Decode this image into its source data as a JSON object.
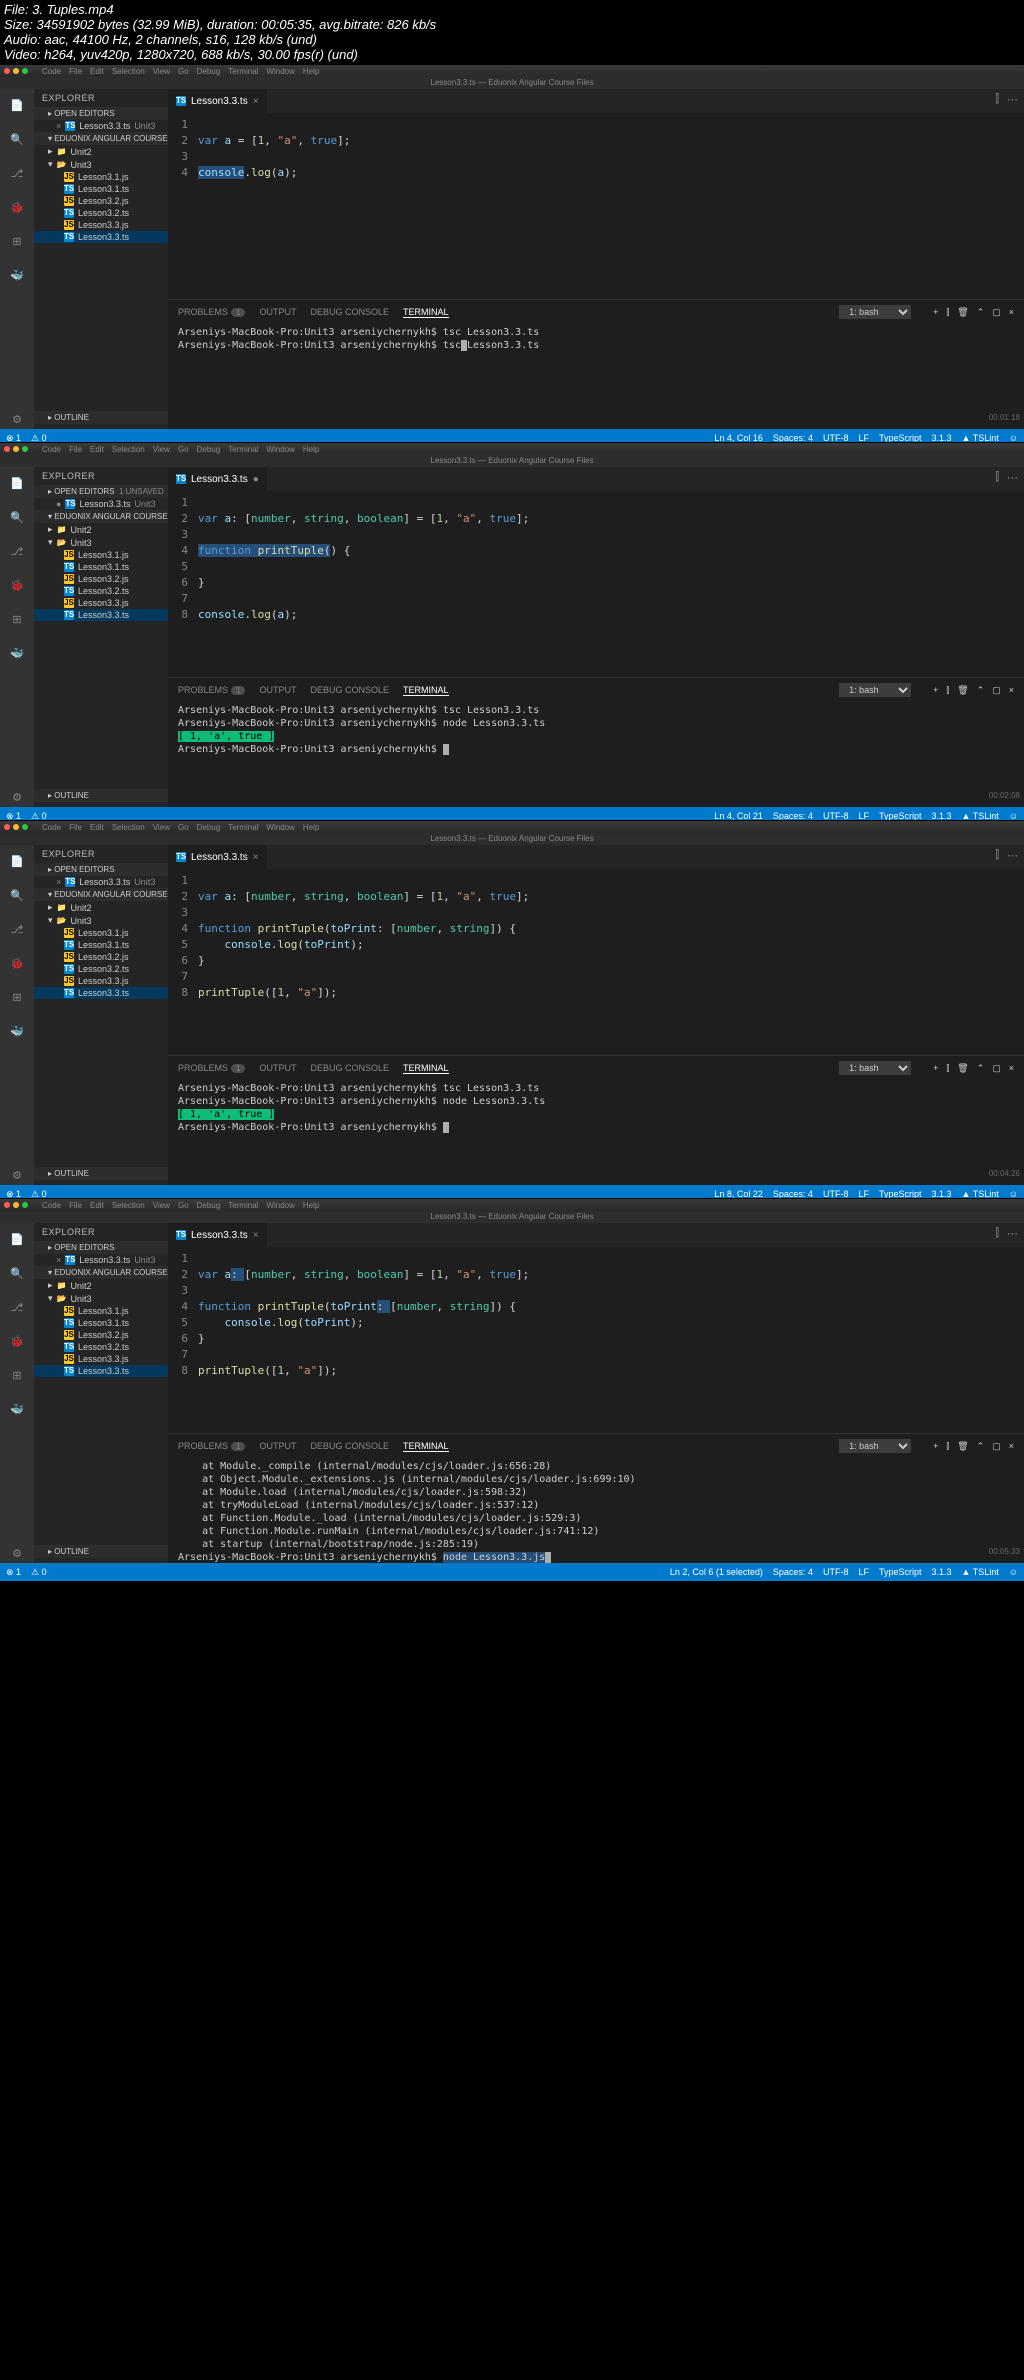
{
  "meta": {
    "file": "File: 3. Tuples.mp4",
    "size": "Size: 34591902 bytes (32.99 MiB), duration: 00:05:35, avg.bitrate: 826 kb/s",
    "audio": "Audio: aac, 44100 Hz, 2 channels, s16, 128 kb/s (und)",
    "video": "Video: h264, yuv420p, 1280x720, 688 kb/s, 30.00 fps(r) (und)"
  },
  "menubar": [
    "Code",
    "File",
    "Edit",
    "Selection",
    "View",
    "Go",
    "Debug",
    "Terminal",
    "Window",
    "Help"
  ],
  "explorer": {
    "title": "EXPLORER",
    "openEditors": "OPEN EDITORS",
    "project": "EDUONIX ANGULAR COURSE FILES",
    "outline": "OUTLINE",
    "tabFile": "Lesson3.3.ts",
    "tabGroup": "Unit3",
    "folders": {
      "unit2": "Unit2",
      "unit3": "Unit3"
    },
    "files": [
      "Lesson3.1.js",
      "Lesson3.1.ts",
      "Lesson3.2.js",
      "Lesson3.2.ts",
      "Lesson3.3.js",
      "Lesson3.3.ts"
    ]
  },
  "panel": {
    "problems": "PROBLEMS",
    "pcount": "1",
    "output": "OUTPUT",
    "debug": "DEBUG CONSOLE",
    "terminal": "TERMINAL",
    "shell": "1: bash"
  },
  "statusCommon": {
    "errors": "⊗ 1",
    "warnings": "⚠ 0",
    "spaces": "Spaces: 4",
    "enc": "UTF-8",
    "eol": "LF",
    "lang": "TypeScript",
    "ver": "3.1.3",
    "tslint": "▲ TSLint",
    "smile": "☺"
  },
  "shots": [
    {
      "unsaved": "",
      "code": {
        "lines": 4,
        "html": [
          "",
          "<span class='kw'>var</span> <span class='id'>a</span> = [<span class='num'>1</span>, <span class='str'>\"a\"</span>, <span class='kw'>true</span>];",
          "",
          "<span class='id selbg'>console</span>.<span class='fn'>log</span>(<span class='id'>a</span>);"
        ]
      },
      "term": [
        "Arseniys-MacBook-Pro:Unit3 arseniychernykh$ tsc Lesson3.3.ts",
        "Arseniys-MacBook-Pro:Unit3 arseniychernykh$ tsc<span class='cur'> </span>Lesson3.3.ts"
      ],
      "status": "Ln 4, Col 16",
      "time": "00:01:18"
    },
    {
      "unsaved": "1 UNSAVED",
      "tabDirty": true,
      "code": {
        "lines": 8,
        "html": [
          "",
          "<span class='kw'>var</span> <span class='id'>a</span>: [<span class='ty'>number</span>, <span class='ty'>string</span>, <span class='ty'>boolean</span>] = [<span class='num'>1</span>, <span class='str'>\"a\"</span>, <span class='kw'>true</span>];",
          "",
          "<span class='selbg'><span class='kw'>function</span> <span class='fn'>printTuple</span>(</span>) {",
          "    ",
          "}",
          "",
          "<span class='id'>console</span>.<span class='fn'>log</span>(<span class='id'>a</span>);"
        ]
      },
      "term": [
        "Arseniys-MacBook-Pro:Unit3 arseniychernykh$ tsc Lesson3.3.ts",
        "Arseniys-MacBook-Pro:Unit3 arseniychernykh$ node Lesson3.3.ts",
        "<span class='out'>[ 1, 'a', true ]</span>",
        "Arseniys-MacBook-Pro:Unit3 arseniychernykh$ <span class='cur'> </span>"
      ],
      "status": "Ln 4, Col 21",
      "time": "00:02:08"
    },
    {
      "unsaved": "",
      "code": {
        "lines": 8,
        "html": [
          "",
          "<span class='kw'>var</span> <span class='id'>a</span>: [<span class='ty'>number</span>, <span class='ty'>string</span>, <span class='ty'>boolean</span>] = [<span class='num'>1</span>, <span class='str'>\"a\"</span>, <span class='kw'>true</span>];",
          "",
          "<span class='kw'>function</span> <span class='fn'>printTuple</span>(<span class='id'>toPrint</span>: [<span class='ty'>number</span>, <span class='ty'>string</span>]) {",
          "    <span class='id'>console</span>.<span class='fn'>log</span>(<span class='id'>toPrint</span>);",
          "}",
          "",
          "<span class='fn'>printTuple</span>([<span class='num'>1</span>, <span class='str'>\"a\"</span>]);"
        ]
      },
      "term": [
        "Arseniys-MacBook-Pro:Unit3 arseniychernykh$ tsc Lesson3.3.ts",
        "Arseniys-MacBook-Pro:Unit3 arseniychernykh$ node Lesson3.3.ts",
        "<span class='out'>[ 1, 'a', true ]</span>",
        "Arseniys-MacBook-Pro:Unit3 arseniychernykh$ <span class='cur'> </span>"
      ],
      "status": "Ln 8, Col 22",
      "time": "00:04:26"
    },
    {
      "unsaved": "",
      "code": {
        "lines": 8,
        "html": [
          "",
          "<span class='kw'>var</span> <span class='id'>a</span><span class='selbg'>: </span>[<span class='ty'>number</span>, <span class='ty'>string</span>, <span class='ty'>boolean</span>] = [<span class='num'>1</span>, <span class='str'>\"a\"</span>, <span class='kw'>true</span>];",
          "",
          "<span class='kw'>function</span> <span class='fn'>printTuple</span>(<span class='id'>toPrint</span><span class='selbg'>: </span>[<span class='ty'>number</span>, <span class='ty'>string</span>]) {",
          "    <span class='id'>console</span>.<span class='fn'>log</span>(<span class='id'>toPrint</span>);",
          "}",
          "",
          "<span class='fn'>printTuple</span>([<span class='num'>1</span>, <span class='str'>\"a\"</span>]);"
        ]
      },
      "term": [
        "    at Module._compile (internal/modules/cjs/loader.js:656:28)",
        "    at Object.Module._extensions..js (internal/modules/cjs/loader.js:699:10)",
        "    at Module.load (internal/modules/cjs/loader.js:598:32)",
        "    at tryModuleLoad (internal/modules/cjs/loader.js:537:12)",
        "    at Function.Module._load (internal/modules/cjs/loader.js:529:3)",
        "    at Function.Module.runMain (internal/modules/cjs/loader.js:741:12)",
        "    at startup (internal/bootstrap/node.js:285:19)",
        "Arseniys-MacBook-Pro:Unit3 arseniychernykh$ <span class='selbg'>node Lesson3.3.js</span><span class='cur'> </span>"
      ],
      "status": "Ln 2, Col 6 (1 selected)",
      "time": "00:05:33"
    }
  ]
}
